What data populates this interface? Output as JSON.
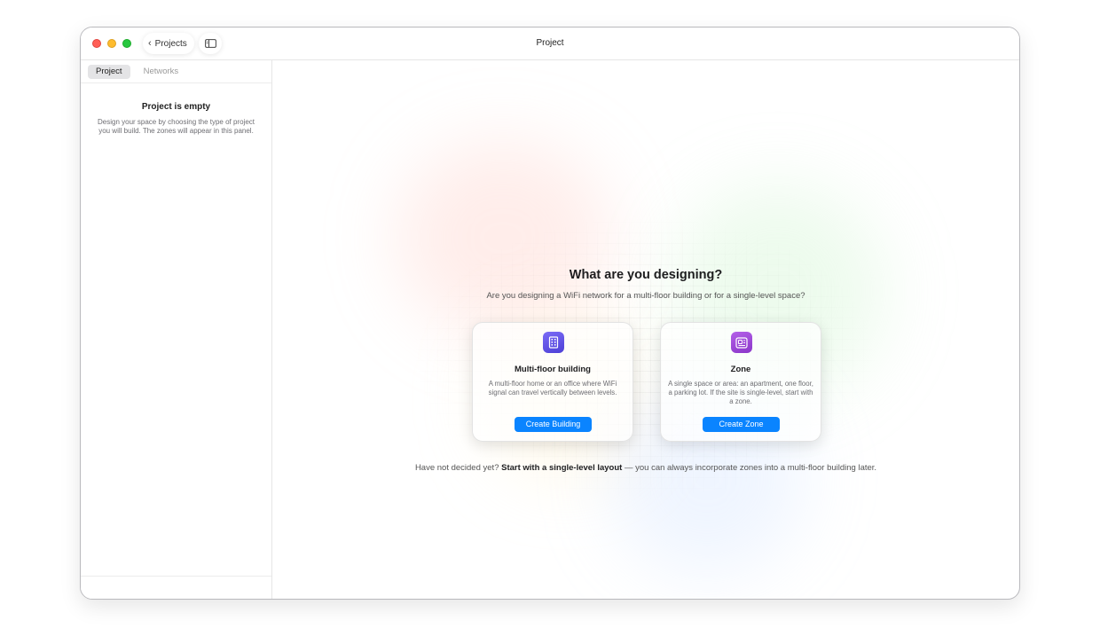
{
  "titlebar": {
    "back_label": "Projects",
    "title": "Project"
  },
  "sidebar": {
    "tabs": [
      {
        "label": "Project",
        "active": true
      },
      {
        "label": "Networks",
        "active": false
      }
    ],
    "empty_title": "Project is empty",
    "empty_description": "Design your space by choosing the type of project you will build. The zones will appear in this panel."
  },
  "main": {
    "headline": "What are you designing?",
    "subheadline": "Are you designing a WiFi network for a multi-floor building or for a single-level space?",
    "cards": [
      {
        "icon": "building-icon",
        "title": "Multi-floor building",
        "description": "A multi-floor home or an office where WiFi signal can travel vertically between levels.",
        "button_label": "Create Building"
      },
      {
        "icon": "zone-icon",
        "title": "Zone",
        "description": "A single space or area: an apartment, one floor, a parking lot. If the site is single-level, start with a zone.",
        "button_label": "Create Zone"
      }
    ],
    "footnote": {
      "prefix": "Have not decided yet?",
      "link": "Start with a single-level layout",
      "suffix": "— you can always incorporate zones into a multi-floor building later."
    }
  },
  "colors": {
    "accent": "#0a84ff",
    "building_icon": "#5b4ce0",
    "zone_icon": "#9b45d6",
    "close": "#ff5f57",
    "minimize": "#febc2e",
    "zoom": "#28c840"
  }
}
